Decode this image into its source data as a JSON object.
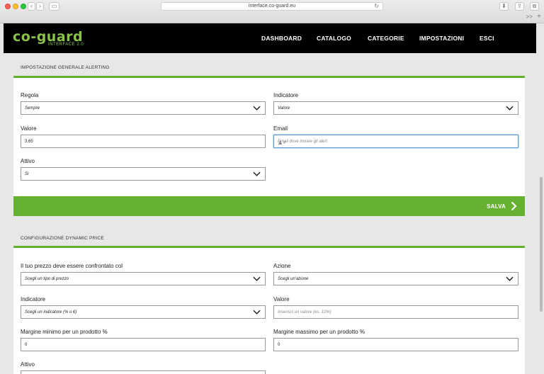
{
  "browser": {
    "url": "interface.co-guard.eu",
    "overflow_label": ">>",
    "new_tab_label": "+"
  },
  "header": {
    "logo_text": "co-guard",
    "logo_subtext": "INTERFACE 2.0",
    "nav": [
      "DASHBOARD",
      "CATALOGO",
      "CATEGORIE",
      "IMPOSTAZIONI",
      "ESCI"
    ]
  },
  "alerting": {
    "title": "IMPOSTAZIONE GENERALE ALERTING",
    "regola": {
      "label": "Regola",
      "value": "Sempre"
    },
    "indicatore": {
      "label": "Indicatore",
      "value": "Valore"
    },
    "valore": {
      "label": "Valore",
      "value": "3,65"
    },
    "email": {
      "label": "Email",
      "placeholder": "Email dove inviare gli alert"
    },
    "attivo": {
      "label": "Attivo",
      "value": "Sì"
    },
    "save_label": "SALVA"
  },
  "dynamic_price": {
    "title": "CONFIGURAZIONE DYNAMIC PRICE",
    "confronto": {
      "label": "Il tuo prezzo deve essere confrontato col",
      "value": "Scegli un tipo di prezzo"
    },
    "azione": {
      "label": "Azione",
      "value": "Scegli un'azione"
    },
    "indicatore": {
      "label": "Indicatore",
      "value": "Scegli un indicatore (% o €)"
    },
    "valore": {
      "label": "Valore",
      "placeholder": "Inserisci un valore (es. 10%)"
    },
    "margine_min": {
      "label": "Margine minimo per un prodotto %",
      "value": "0"
    },
    "margine_max": {
      "label": "Margine massimo per un prodotto %",
      "value": "0"
    },
    "attivo": {
      "label": "Attivo"
    }
  },
  "colors": {
    "accent": "#66b032",
    "header_bg": "#000000",
    "logo": "#8bc34a"
  }
}
